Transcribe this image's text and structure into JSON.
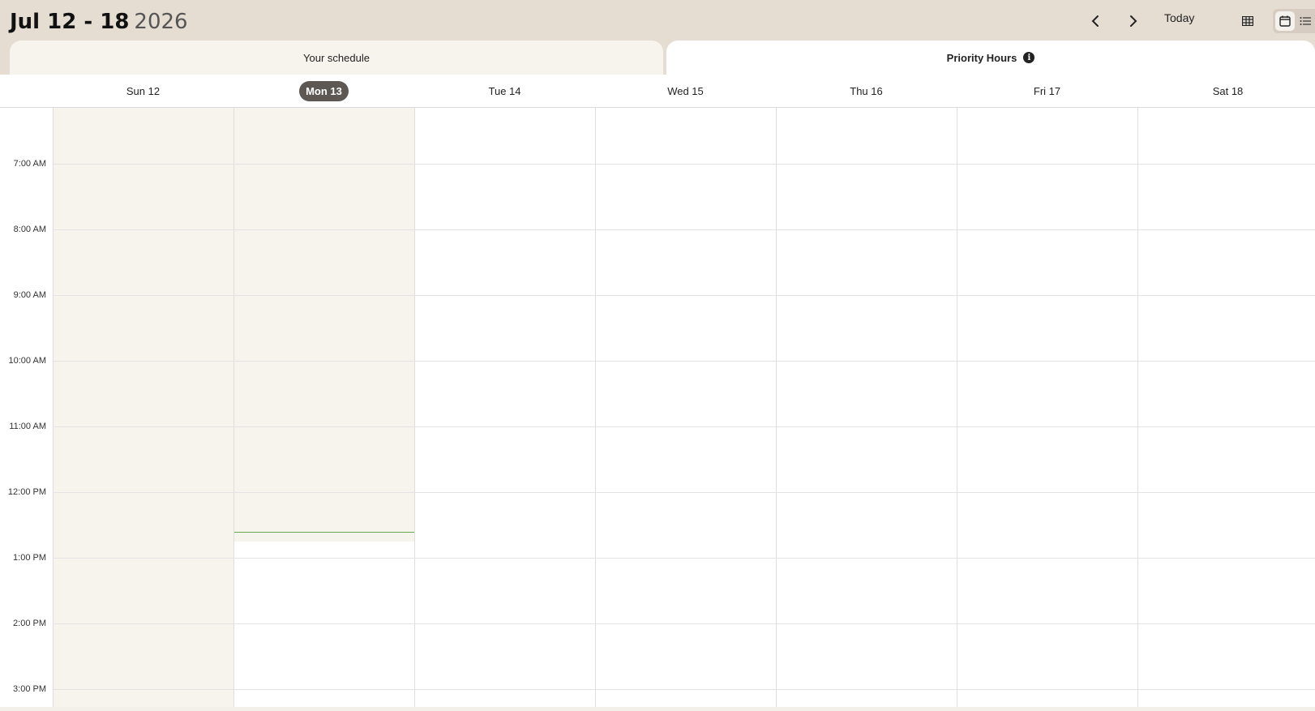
{
  "header": {
    "range": "Jul 12 - 18",
    "year": "2026",
    "today_label": "Today"
  },
  "tabs": [
    {
      "label": "Your schedule",
      "active": false
    },
    {
      "label": "Priority Hours",
      "active": true
    }
  ],
  "days": [
    {
      "label": "Sun 12",
      "today": false,
      "past": true
    },
    {
      "label": "Mon 13",
      "today": true,
      "past": true
    },
    {
      "label": "Tue 14",
      "today": false,
      "past": false
    },
    {
      "label": "Wed 15",
      "today": false,
      "past": false
    },
    {
      "label": "Thu 16",
      "today": false,
      "past": false
    },
    {
      "label": "Fri 17",
      "today": false,
      "past": false
    },
    {
      "label": "Sat 18",
      "today": false,
      "past": false
    }
  ],
  "times": [
    "7:00 AM",
    "8:00 AM",
    "9:00 AM",
    "10:00 AM",
    "11:00 AM",
    "12:00 PM",
    "1:00 PM",
    "2:00 PM",
    "3:00 PM"
  ],
  "current_time_indicator": {
    "day": "Mon 13",
    "color": "#6aa84f"
  },
  "colors": {
    "header_bg": "#e5dcd2",
    "past_bg": "#f7f3ed",
    "today_pill": "#5d5853"
  }
}
